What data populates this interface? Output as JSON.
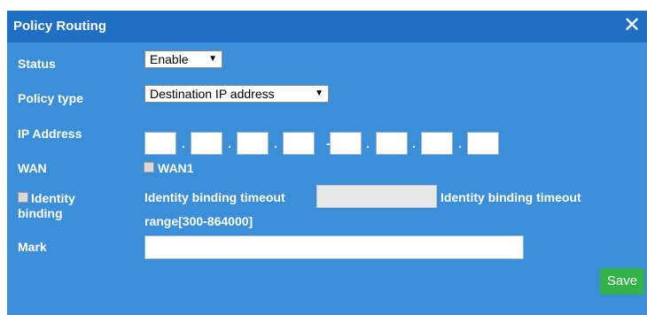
{
  "dialog": {
    "title": "Policy Routing",
    "close_glyph": "✕"
  },
  "form": {
    "status_label": "Status",
    "status_value": "Enable",
    "policy_type_label": "Policy type",
    "policy_type_value": "Destination IP address",
    "ip_address_label": "IP Address",
    "ip_separator_dot": ".",
    "ip_separator_dash": "-",
    "wan_label": "WAN",
    "wan_option": "WAN1",
    "identity_label_line1": "Identity",
    "identity_label_line2": "binding",
    "identity_timeout_label": "Identity binding timeout",
    "identity_timeout_range_label": "Identity binding timeout",
    "identity_timeout_range": "range[300-864000]",
    "mark_label": "Mark"
  },
  "actions": {
    "save_label": "Save"
  },
  "icons": {
    "dropdown": "▼"
  },
  "colors": {
    "dialog_bg": "#3b8fd9",
    "titlebar_bg": "#1f6fc2",
    "save_bg": "#34b24a"
  }
}
